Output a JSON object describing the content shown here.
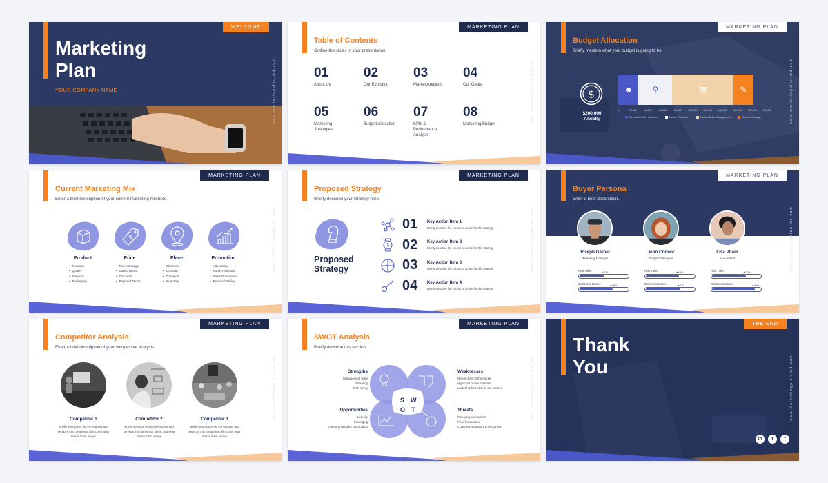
{
  "colors": {
    "navy": "#1f2a4f",
    "overlay_navy": "#2c3a63",
    "orange": "#f5821f",
    "periwinkle": "#8f97e3",
    "blue": "#4a58c7",
    "peach": "#f2d2a9"
  },
  "website": "www.marketingplan.md.com",
  "header_tag": "MARKETING PLAN",
  "slides": {
    "cover": {
      "tag": "WELCOME",
      "title_line1": "Marketing",
      "title_line2": "Plan",
      "company": "YOUR COMPANY NAME"
    },
    "toc": {
      "title": "Table of Contents",
      "subtitle": "Outline the slides in your presentation.",
      "items": [
        {
          "num": "01",
          "label": "About Us"
        },
        {
          "num": "02",
          "label": "Our Evolution"
        },
        {
          "num": "03",
          "label": "Market Analysis"
        },
        {
          "num": "04",
          "label": "Our Goals"
        },
        {
          "num": "05",
          "label": "Marketing Strategies"
        },
        {
          "num": "06",
          "label": "Budget Allocation"
        },
        {
          "num": "07",
          "label": "KPIs & Performance Analysis"
        },
        {
          "num": "08",
          "label": "Marketing Budget"
        }
      ]
    },
    "budget": {
      "title": "Budget Allocation",
      "subtitle": "Briefly mention what your budget is going to be.",
      "amount": "$200,000",
      "period": "Anually",
      "icon": "dollar-coin-icon"
    },
    "mix": {
      "title": "Current Marketing Mix",
      "subtitle": "Enter a brief description of your current marketing mix here.",
      "columns": [
        {
          "icon": "box-icon",
          "heading": "Product",
          "items": [
            "Features",
            "Quality",
            "Services",
            "Packaging"
          ]
        },
        {
          "icon": "price-tag-icon",
          "heading": "Price",
          "items": [
            "Price Strategy",
            "Subscriptions",
            "Discounts",
            "Payment Terms"
          ]
        },
        {
          "icon": "location-pin-icon",
          "heading": "Place",
          "items": [
            "Channels",
            "Location",
            "Transport",
            "Inventory"
          ]
        },
        {
          "icon": "growth-chart-icon",
          "heading": "Promotion",
          "items": [
            "Advertising",
            "Public Relations",
            "Sales Promotions",
            "Personal Selling"
          ]
        }
      ]
    },
    "strategy": {
      "title": "Proposed Strategy",
      "subtitle": "Briefly describe your strategy here.",
      "big_title_line1": "Proposed",
      "big_title_line2": "Strategy",
      "actions": [
        {
          "num": "01",
          "icon": "network-icon",
          "title": "Key Action Item 1",
          "desc": "Briefly describe the course of action for this strategy"
        },
        {
          "num": "02",
          "icon": "watch-icon",
          "title": "Key Action Item 2",
          "desc": "Briefly describe the course of action for this strategy"
        },
        {
          "num": "03",
          "icon": "puzzle-icon",
          "title": "Key Action Item 3",
          "desc": "Briefly describe the course of action for this strategy"
        },
        {
          "num": "04",
          "icon": "key-icon",
          "title": "Key Action Item 4",
          "desc": "Briefly describe the course of action for this strategy"
        }
      ]
    },
    "persona": {
      "title": "Buyer Persona",
      "subtitle": "Enter a brief description.",
      "trait_labels": [
        "Risk Taker",
        "Optimistic Nature"
      ],
      "people": [
        {
          "name": "Joseph Garner",
          "role": "Marketing Manager",
          "risk_taker": 50,
          "optimistic": 68
        },
        {
          "name": "Jenn Connor",
          "role": "Graphic Designer",
          "risk_taker": 68,
          "optimistic": 71
        },
        {
          "name": "Lisa Pham",
          "role": "Accountant",
          "risk_taker": 70,
          "optimistic": 88
        }
      ]
    },
    "competitor": {
      "title": "Competitor Analysis",
      "subtitle": "Enter a brief description of your competitive analysis.",
      "items": [
        {
          "name": "Competitor 1",
          "desc": "Briefly describe or list the features and services this competitor offers, and what makes them unique"
        },
        {
          "name": "Competitor 2",
          "desc": "Briefly describe or list the features and services this competitor offers, and what makes them unique"
        },
        {
          "name": "Competitor 3",
          "desc": "Briefly describe or list the features and services this competitor offers, and what makes them unique"
        }
      ]
    },
    "swot": {
      "title": "SWOT Analysis",
      "subtitle": "Briefly describe this section.",
      "letters": [
        "S",
        "W",
        "O",
        "T"
      ],
      "strengths": {
        "heading": "Strengths",
        "items": [
          "Management team",
          "Marketing",
          "Tech-savvy"
        ]
      },
      "weaknesses": {
        "heading": "Weaknesses",
        "items": [
          "New entrant to the market",
          "High cost of raw materials",
          "Lack of skilled labor in the market"
        ]
      },
      "opportunities": {
        "heading": "Opportunities",
        "items": [
          "Diversify",
          "Packaging",
          "Emerging need for our product"
        ]
      },
      "threats": {
        "heading": "Threats",
        "items": [
          "Emerging competitors",
          "Price fluctuations",
          "Changing regulatory environment"
        ]
      }
    },
    "end": {
      "tag": "THE END",
      "title_line1": "Thank",
      "title_line2": "You",
      "social": [
        {
          "icon": "linkedin-icon",
          "glyph": "in"
        },
        {
          "icon": "twitter-icon",
          "glyph": "t"
        },
        {
          "icon": "facebook-icon",
          "glyph": "f"
        }
      ]
    }
  },
  "chart_data": {
    "type": "bar",
    "orientation": "horizontal-stacked",
    "title": "Budget Allocation",
    "categories": [
      "Recruitment & Hardware",
      "Market Research",
      "Social Media Management",
      "Creative/Design"
    ],
    "values": [
      30000,
      50000,
      90000,
      30000
    ],
    "colors": [
      "#4a58c7",
      "#f0f1f6",
      "#f2d2a9",
      "#f5821f"
    ],
    "x_ticks": [
      "0",
      "20,000",
      "40,000",
      "60,000",
      "80,000",
      "100,000",
      "120,000",
      "140,000",
      "160,000",
      "180,000",
      "200,000"
    ],
    "xlim": [
      0,
      200000
    ],
    "legend": "bottom",
    "xlabel": "",
    "ylabel": ""
  }
}
